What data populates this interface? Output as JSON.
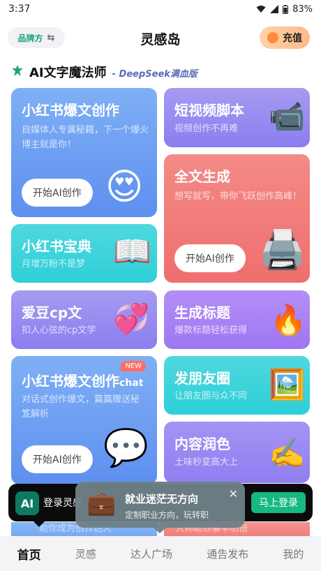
{
  "status_bar": {
    "time": "3:37",
    "battery": "83%"
  },
  "header": {
    "brand_label": "品牌方",
    "swap_icon": "swap-icon",
    "title": "灵感岛",
    "recharge_label": "充值"
  },
  "section": {
    "title": "AI文字魔法师",
    "subtitle": "- DeepSeek满血版"
  },
  "cards": {
    "xhs_article": {
      "title": "小红书爆文创作",
      "desc": "自媒体人专属秘籍，下一个爆火博主就是你！",
      "cta": "开始AI创作",
      "icon": "heart-eyes-emoji"
    },
    "short_video": {
      "title": "短视频脚本",
      "desc": "视频创作不再难",
      "icon": "video-camera-icon"
    },
    "full_text": {
      "title": "全文生成",
      "desc": "想写就写，带你飞跃创作高峰！",
      "cta": "开始AI创作",
      "icon": "printer-icon"
    },
    "xhs_guide": {
      "title": "小红书宝典",
      "desc": "月增万粉不是梦",
      "icon": "open-book-icon"
    },
    "idol_cp": {
      "title": "爱豆cp文",
      "desc": "扣人心弦的cp文学",
      "icon": "two-hearts-icon"
    },
    "gen_title": {
      "title": "生成标题",
      "desc": "爆款标题轻松获得",
      "icon": "fire-icon"
    },
    "xhs_chat": {
      "title": "小红书爆文创作",
      "title_suffix": "chat",
      "badge": "NEW",
      "desc": "对话式创作爆文，篇篇赠送秘笈解析",
      "cta": "开始AI创作",
      "icon": "speech-bubble-icon"
    },
    "moments": {
      "title": "发朋友圈",
      "desc": "让朋友圈与众不同",
      "icon": "framed-picture-icon"
    },
    "polish": {
      "title": "内容润色",
      "desc": "土味秒变高大上",
      "icon": "writing-hand-icon"
    }
  },
  "login_bar": {
    "logo_text": "AI",
    "text": "登录灵感",
    "button": "马上登录"
  },
  "popup": {
    "title": "就业迷茫无方向",
    "subtitle": "定制职业方向，玩转职",
    "close_icon": "close-icon",
    "icon": "briefcase-icon"
  },
  "peek": {
    "left": "助你成为创作达人",
    "right": "大师助你事半功倍"
  },
  "tabbar": {
    "tabs": [
      {
        "label": "首页",
        "active": true
      },
      {
        "label": "灵感",
        "active": false
      },
      {
        "label": "达人广场",
        "active": false
      },
      {
        "label": "通告发布",
        "active": false
      },
      {
        "label": "我的",
        "active": false
      }
    ]
  },
  "colors": {
    "accent_green": "#1aa37a",
    "login_green": "#17b882",
    "card_blue": "#6a9bf2",
    "card_purple": "#9a8df1",
    "card_red": "#f07a78",
    "card_cyan": "#3dd3db",
    "card_violet": "#a984f4"
  }
}
